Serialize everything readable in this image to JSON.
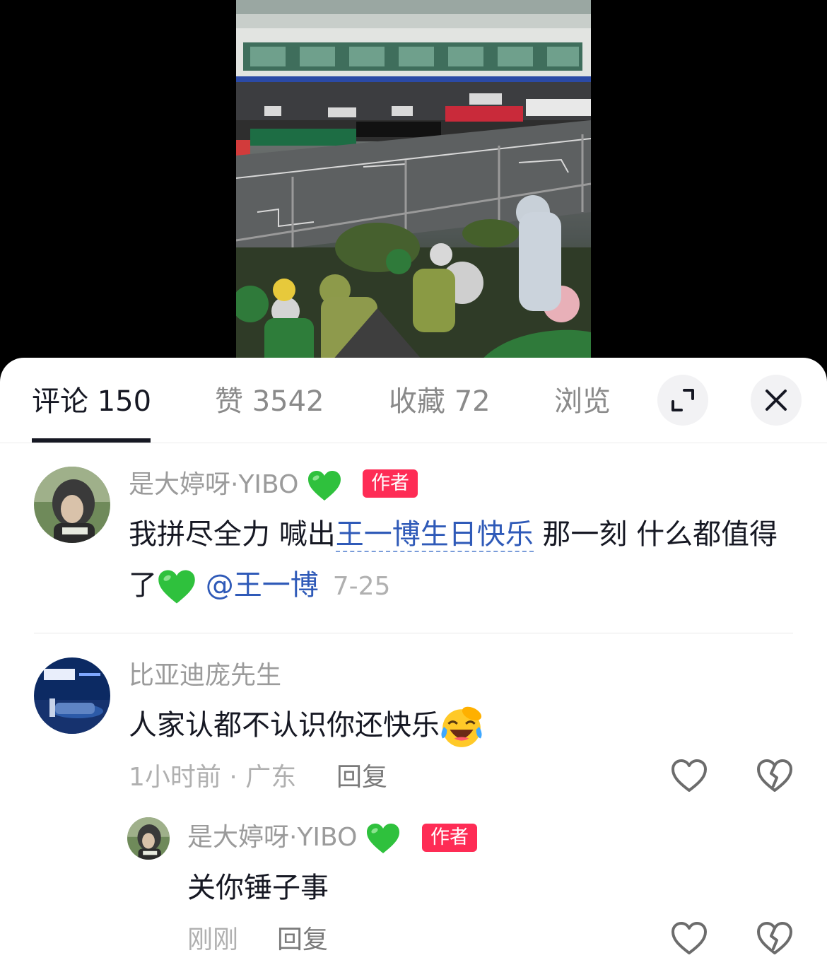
{
  "tabs": {
    "comments": "评论 150",
    "likes": "赞 3542",
    "favorites": "收藏 72",
    "views": "浏览"
  },
  "comments": [
    {
      "username": "是大婷呀·YIBO",
      "username_emoji": "green-heart-icon",
      "badge": "作者",
      "text_before": "我拼尽全力 喊出",
      "topic": "王一博生日快乐",
      "text_after": " 那一刻 什么都值得了",
      "mention": "@王一博",
      "date": "7-25"
    },
    {
      "username": "比亚迪庞先生",
      "text": "人家认都不认识你还快乐",
      "text_emoji": "laughing-crying-icon",
      "time": "1小时前 · 广东",
      "reply_label": "回复"
    },
    {
      "username": "是大婷呀·YIBO",
      "username_emoji": "green-heart-icon",
      "badge": "作者",
      "text": "关你锤子事",
      "time": "刚刚",
      "reply_label": "回复"
    }
  ],
  "colors": {
    "accent": "#fe2c55",
    "link": "#2f5ab8",
    "text": "#161823",
    "muted": "#9b9b9b"
  }
}
